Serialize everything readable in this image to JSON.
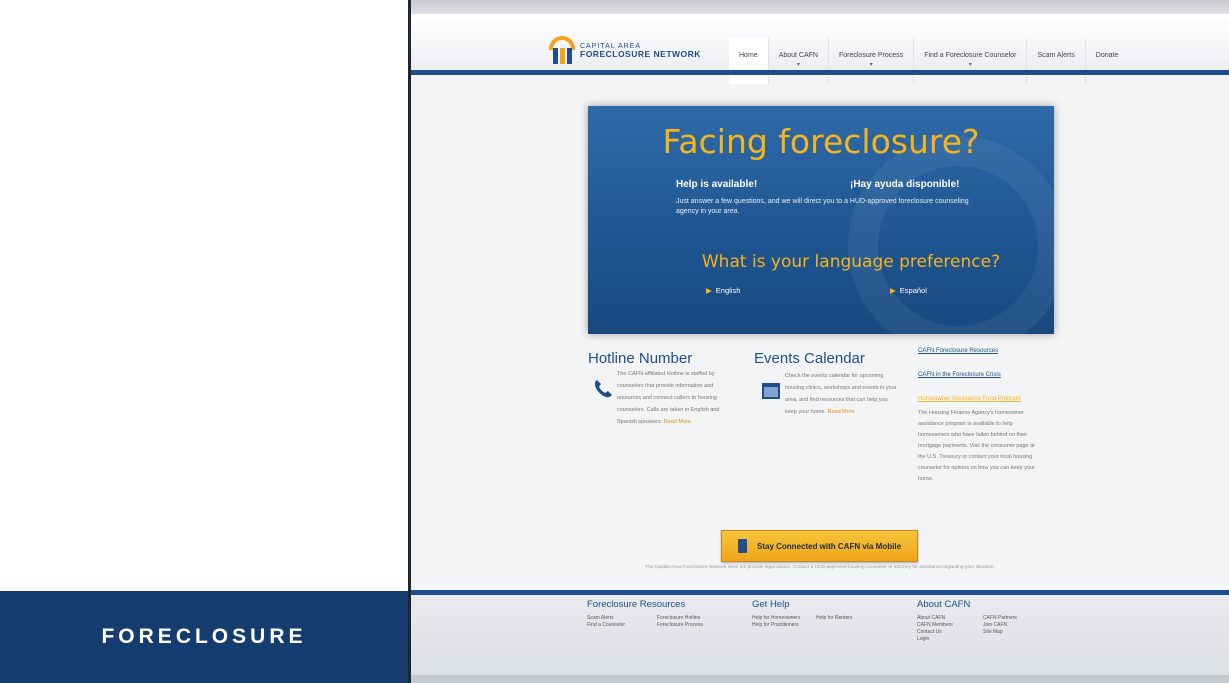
{
  "panel": {
    "label": "FORECLOSURE",
    "colors": {
      "navy": "#143c6e",
      "accent": "#f6b41d"
    }
  },
  "site": {
    "logo": {
      "line1": "CAPITAL AREA",
      "line2": "FORECLOSURE NETWORK"
    },
    "nav": [
      {
        "label": "Home",
        "caret": ""
      },
      {
        "label": "About CAFN",
        "caret": "▾"
      },
      {
        "label": "Foreclosure Process",
        "caret": "▾"
      },
      {
        "label": "Find a Foreclosure Counselor",
        "caret": "▾"
      },
      {
        "label": "Scam Alerts",
        "caret": ""
      },
      {
        "label": "Donate",
        "caret": ""
      }
    ],
    "hero": {
      "title": "Facing foreclosure?",
      "help_en": "Help is available!",
      "help_es": "¡Hay ayuda disponible!",
      "description": "Just answer a few questions, and we will direct you to a HUD-approved foreclosure counseling agency in your area.",
      "question": "What is your language preference?",
      "english": "English",
      "espanol": "Español"
    },
    "hotline": {
      "title": "Hotline Number",
      "text": "The CAFN-affiliated Hotline is staffed by counselors that provide information and resources and connect callers to housing counselors. Calls are taken in English and Spanish speakers.",
      "more": "Read More"
    },
    "events": {
      "title": "Events Calendar",
      "text": "Check the events calendar for upcoming housing clinics, workshops and events in your area, and find resources that can help you keep your home.",
      "more": "Read More"
    },
    "sidebar": {
      "link1": "CAFN Foreclosure Resources",
      "link2": "CAFN in the Foreclosure Crisis",
      "link3": "Homeowner Assistance Fund Program",
      "text": "The Housing Finance Agency's homeowner assistance program is available to help homeowners who have fallen behind on their mortgage payments. Visit the consumer page at the U.S. Treasury or contact your local housing counselor for options on how you can keep your home."
    },
    "mobile_button": "Stay Connected with CAFN via Mobile",
    "disclaimer": "The Capital Area Foreclosure Network does not provide legal advice. Contact a HUD-approved housing counselor or attorney for assistance regarding your situation.",
    "footer": {
      "col1_title": "Foreclosure Resources",
      "col1_links_a": [
        "Scam Alerts",
        "Find a Counselor"
      ],
      "col1_links_b": [
        "Foreclosure Hotline",
        "Foreclosure Process"
      ],
      "col2_title": "Get Help",
      "col2_links_a": [
        "Help for Homeowners",
        "Help for Practitioners"
      ],
      "col2_links_b": [
        "Help for Renters"
      ],
      "col3_title": "About CAFN",
      "col3_links_a": [
        "About CAFN",
        "CAFN Members",
        "Contact Us",
        "Login"
      ],
      "col3_links_b": [
        "CAFN Partners",
        "Join CAFN",
        "Site Map"
      ]
    }
  }
}
